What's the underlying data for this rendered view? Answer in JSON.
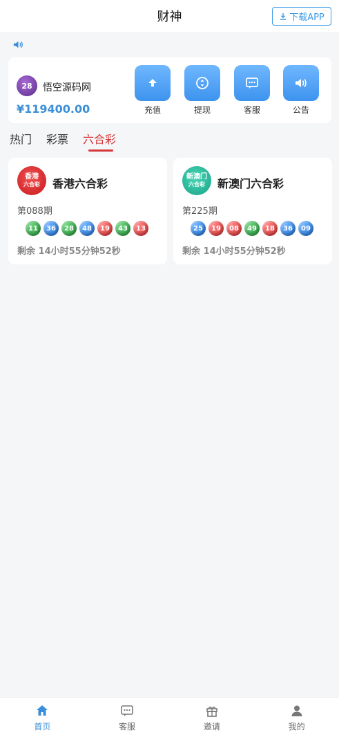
{
  "header": {
    "title": "财神",
    "download_label": "下载APP"
  },
  "account": {
    "avatar_text": "28",
    "username": "悟空源码网",
    "balance": "¥119400.00",
    "actions": [
      {
        "label": "充值",
        "icon": "upload-icon"
      },
      {
        "label": "提现",
        "icon": "withdraw-icon"
      },
      {
        "label": "客服",
        "icon": "chat-icon"
      },
      {
        "label": "公告",
        "icon": "speaker-icon"
      }
    ]
  },
  "tabs": [
    {
      "label": "热门",
      "active": false
    },
    {
      "label": "彩票",
      "active": false
    },
    {
      "label": "六合彩",
      "active": true
    }
  ],
  "lotteries": [
    {
      "name": "香港六合彩",
      "logo_line1": "香港",
      "logo_line2": "六合彩",
      "period": "第088期",
      "balls": [
        {
          "num": "11",
          "color": "green"
        },
        {
          "num": "36",
          "color": "blue"
        },
        {
          "num": "28",
          "color": "green"
        },
        {
          "num": "48",
          "color": "blue"
        },
        {
          "num": "19",
          "color": "red"
        },
        {
          "num": "43",
          "color": "green"
        },
        {
          "num": "13",
          "color": "red"
        }
      ],
      "countdown": "剩余 14小时55分钟52秒"
    },
    {
      "name": "新澳门六合彩",
      "logo_line1": "新澳门",
      "logo_line2": "六合彩",
      "period": "第225期",
      "balls": [
        {
          "num": "25",
          "color": "blue"
        },
        {
          "num": "19",
          "color": "red"
        },
        {
          "num": "08",
          "color": "red"
        },
        {
          "num": "49",
          "color": "green"
        },
        {
          "num": "18",
          "color": "red"
        },
        {
          "num": "36",
          "color": "blue"
        },
        {
          "num": "09",
          "color": "blue"
        }
      ],
      "countdown": "剩余 14小时55分钟52秒"
    }
  ],
  "bottom_nav": [
    {
      "label": "首页",
      "active": true
    },
    {
      "label": "客服",
      "active": false
    },
    {
      "label": "邀请",
      "active": false
    },
    {
      "label": "我的",
      "active": false
    }
  ],
  "colors": {
    "accent": "#3a8fd8",
    "tab_active": "#d6383a"
  }
}
